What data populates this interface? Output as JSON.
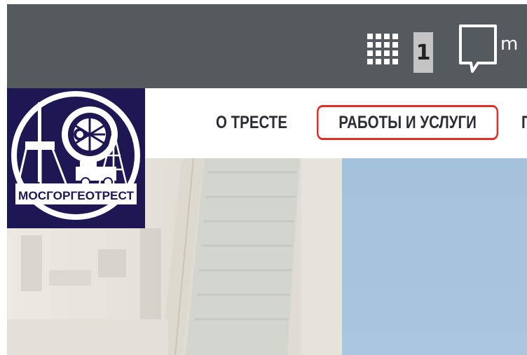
{
  "header": {
    "notification_count": "1",
    "user_text_partial": "m"
  },
  "logo": {
    "text": "МОСГОРГЕОТРЕСТ"
  },
  "nav": {
    "items": [
      {
        "label": "О ТРЕСТЕ"
      },
      {
        "label": "РАБОТЫ И УСЛУГИ",
        "highlighted": true
      },
      {
        "label": "П"
      }
    ]
  },
  "colors": {
    "topbar": "#555a5e",
    "logo_bg": "#1d1854",
    "nav_text": "#2a2d33",
    "highlight": "#e02e26"
  },
  "icons": [
    "apps-grid-icon",
    "chat-bubble-icon"
  ]
}
